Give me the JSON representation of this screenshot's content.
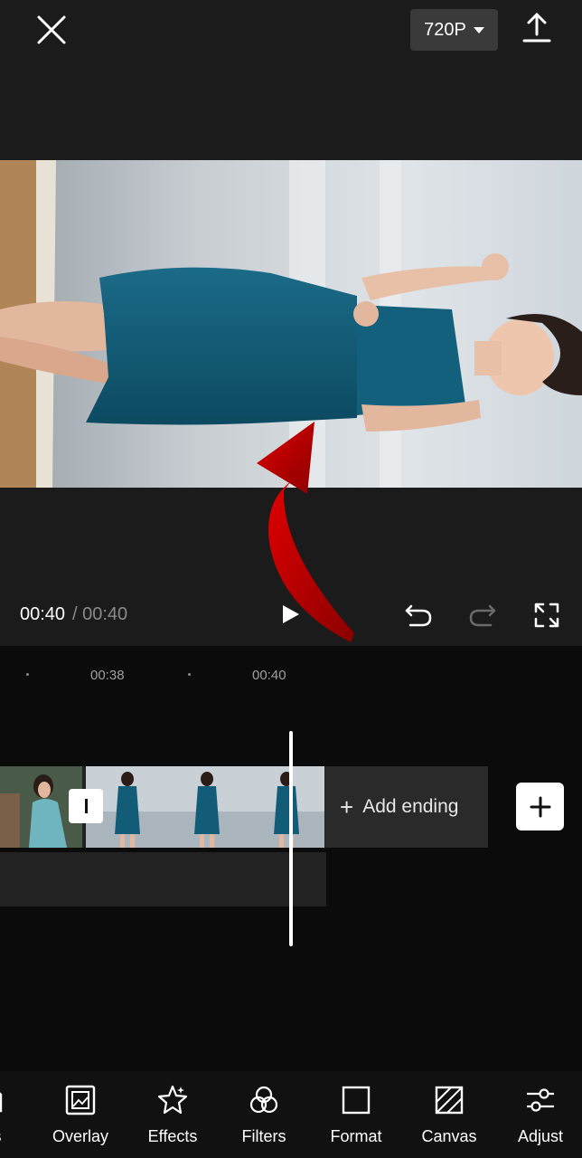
{
  "header": {
    "quality_label": "720P"
  },
  "player": {
    "current_time": "00:40",
    "total_time": "/ 00:40"
  },
  "timeline": {
    "ruler_labels": [
      "00:38",
      "00:40"
    ],
    "add_ending_label": "Add ending"
  },
  "toolbar": {
    "items": [
      {
        "label": "ers",
        "icon": "stickers-icon"
      },
      {
        "label": "Overlay",
        "icon": "overlay-icon"
      },
      {
        "label": "Effects",
        "icon": "effects-icon"
      },
      {
        "label": "Filters",
        "icon": "filters-icon"
      },
      {
        "label": "Format",
        "icon": "format-icon"
      },
      {
        "label": "Canvas",
        "icon": "canvas-icon"
      },
      {
        "label": "Adjust",
        "icon": "adjust-icon"
      }
    ]
  },
  "colors": {
    "background": "#1b1b1b",
    "timeline_background": "#0b0b0b",
    "accent_red": "#d10000",
    "dress": "#0f5570"
  }
}
